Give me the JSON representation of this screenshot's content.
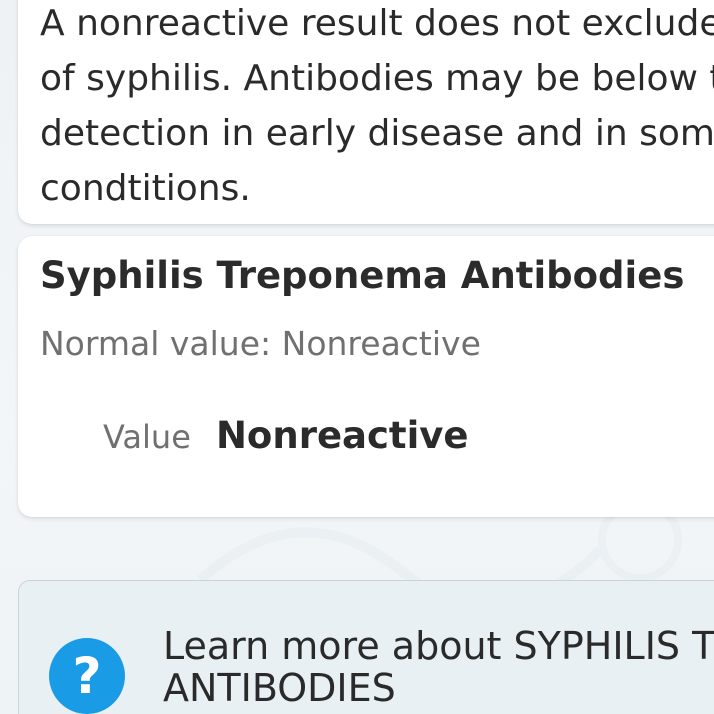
{
  "note": {
    "lines": [
      "A nonreactive result does not exclude",
      "of syphilis. Antibodies may be below t",
      "detection in early disease and in some",
      "condtitions."
    ]
  },
  "result": {
    "title": "Syphilis Treponema Antibodies",
    "normal_value": "Normal value: Nonreactive",
    "value_label": "Value",
    "value": "Nonreactive"
  },
  "learn_more": {
    "icon": "question-icon",
    "icon_glyph": "?",
    "line1": "Learn more about SYPHILIS TP",
    "line2": "ANTIBODIES"
  },
  "colors": {
    "accent": "#1a9be6",
    "background": "#eef2f5",
    "card": "#ffffff",
    "learn_card": "#e8f0f3"
  }
}
